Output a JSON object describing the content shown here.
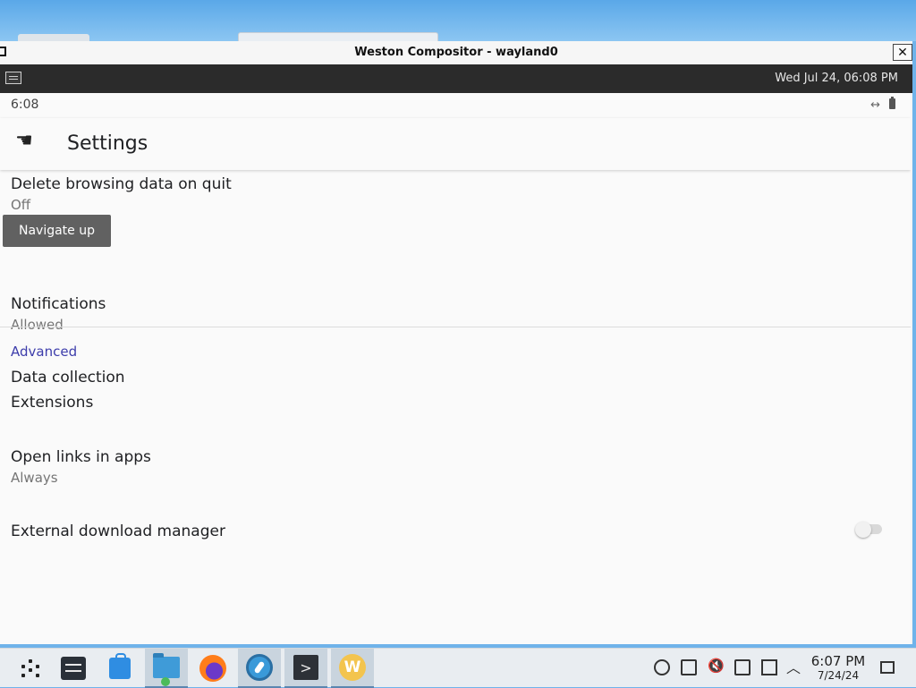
{
  "window": {
    "title": "Weston Compositor - wayland0",
    "close_glyph": "✕"
  },
  "weston_panel": {
    "clock": "Wed Jul 24, 06:08 PM"
  },
  "android": {
    "status_time": "6:08",
    "appbar_title": "Settings",
    "back_glyph": "☚",
    "tooltip": "Navigate up",
    "items": [
      {
        "title": "Delete browsing data on quit",
        "subtitle": "Off"
      },
      {
        "title": "Notifications",
        "subtitle": "Allowed"
      },
      {
        "title": "Data collection",
        "subtitle": ""
      },
      {
        "title": "Extensions",
        "subtitle": ""
      },
      {
        "title": "Open links in apps",
        "subtitle": "Always"
      },
      {
        "title": "External download manager",
        "subtitle": "",
        "toggle": "off"
      }
    ],
    "section_header": "Advanced",
    "header_accent_color": "#3d3dab"
  },
  "taskbar": {
    "apps": [
      "app-launcher",
      "system-settings",
      "discover-store",
      "file-manager",
      "firefox",
      "shortwave",
      "konsole",
      "waydroid"
    ],
    "active_apps": [
      "file-manager",
      "shortwave",
      "konsole",
      "waydroid"
    ],
    "waydroid_letter": "W",
    "konsole_glyph": ">",
    "time": "6:07 PM",
    "date": "7/24/24"
  }
}
